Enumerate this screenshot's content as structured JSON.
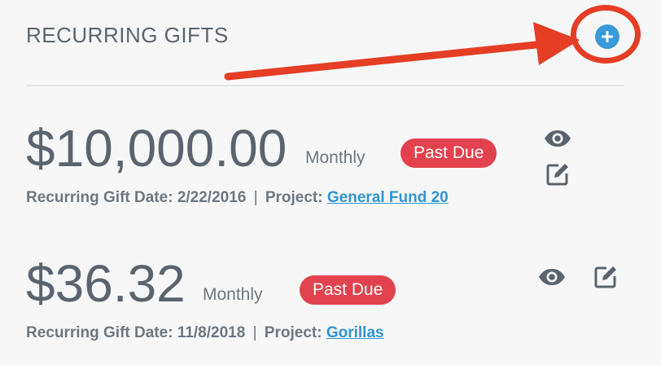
{
  "section": {
    "title": "RECURRING GIFTS",
    "add_icon": "plus-circle-icon"
  },
  "annotation": {
    "color": "#e63d25"
  },
  "gifts": [
    {
      "amount": "$10,000.00",
      "frequency": "Monthly",
      "status": "Past Due",
      "date_label": "Recurring Gift Date:",
      "date": "2/22/2016",
      "project_label": "Project:",
      "project": "General Fund 20",
      "view_icon": "eye-icon",
      "edit_icon": "edit-icon"
    },
    {
      "amount": "$36.32",
      "frequency": "Monthly",
      "status": "Past Due",
      "date_label": "Recurring Gift Date:",
      "date": "11/8/2018",
      "project_label": "Project:",
      "project": "Gorillas",
      "view_icon": "eye-icon",
      "edit_icon": "edit-icon"
    }
  ],
  "colors": {
    "accent": "#3a9ad9",
    "badge": "#e2424e",
    "link": "#2f95d4"
  }
}
